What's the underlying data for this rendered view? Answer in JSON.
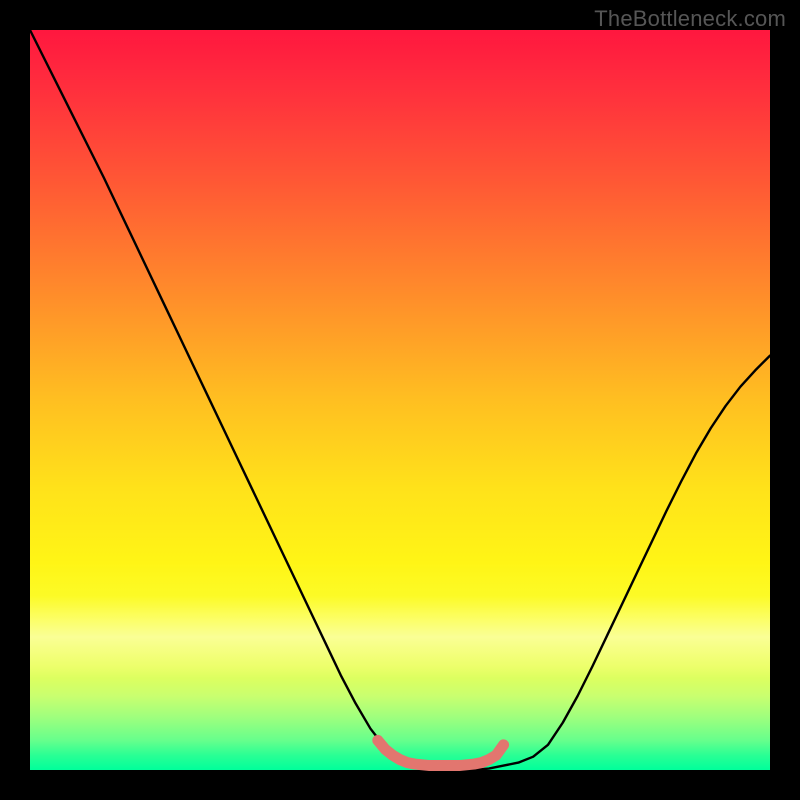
{
  "watermark": "TheBottleneck.com",
  "colors": {
    "background": "#000000",
    "curve_stroke": "#000000",
    "bump_stroke": "#e2766f",
    "gradient_top": "#ff173f",
    "gradient_bottom": "#00ff9b"
  },
  "chart_data": {
    "type": "line",
    "title": "",
    "xlabel": "",
    "ylabel": "",
    "xlim": [
      0,
      1
    ],
    "ylim": [
      0,
      1
    ],
    "x": [
      0.0,
      0.02,
      0.04,
      0.06,
      0.08,
      0.1,
      0.12,
      0.14,
      0.16,
      0.18,
      0.2,
      0.22,
      0.24,
      0.26,
      0.28,
      0.3,
      0.32,
      0.34,
      0.36,
      0.38,
      0.4,
      0.42,
      0.44,
      0.46,
      0.48,
      0.5,
      0.52,
      0.54,
      0.56,
      0.58,
      0.6,
      0.62,
      0.64,
      0.66,
      0.68,
      0.7,
      0.72,
      0.74,
      0.76,
      0.78,
      0.8,
      0.82,
      0.84,
      0.86,
      0.88,
      0.9,
      0.92,
      0.94,
      0.96,
      0.98,
      1.0
    ],
    "values": [
      1.0,
      0.96,
      0.92,
      0.88,
      0.84,
      0.8,
      0.758,
      0.716,
      0.674,
      0.632,
      0.59,
      0.548,
      0.506,
      0.464,
      0.422,
      0.38,
      0.338,
      0.296,
      0.254,
      0.212,
      0.17,
      0.128,
      0.09,
      0.056,
      0.03,
      0.012,
      0.004,
      0.0,
      0.0,
      0.0,
      0.0,
      0.002,
      0.006,
      0.01,
      0.018,
      0.034,
      0.064,
      0.1,
      0.14,
      0.182,
      0.224,
      0.266,
      0.308,
      0.35,
      0.39,
      0.428,
      0.462,
      0.492,
      0.518,
      0.54,
      0.56
    ],
    "series": [
      {
        "name": "highlight-bump",
        "color": "#e2766f",
        "x": [
          0.47,
          0.48,
          0.49,
          0.5,
          0.51,
          0.52,
          0.53,
          0.54,
          0.55,
          0.56,
          0.57,
          0.58,
          0.59,
          0.6,
          0.61,
          0.62,
          0.63,
          0.64
        ],
        "values": [
          0.04,
          0.028,
          0.02,
          0.014,
          0.01,
          0.008,
          0.007,
          0.006,
          0.006,
          0.006,
          0.006,
          0.006,
          0.007,
          0.008,
          0.01,
          0.014,
          0.02,
          0.034
        ]
      }
    ],
    "annotations": []
  }
}
